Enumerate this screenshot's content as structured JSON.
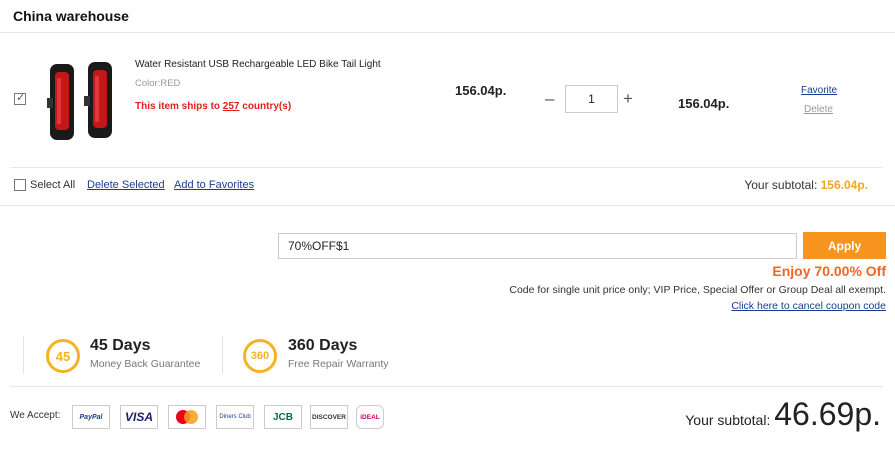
{
  "warehouse": {
    "title": "China warehouse"
  },
  "item": {
    "name": "Water Resistant USB Rechargeable LED Bike Tail Light",
    "color": "Color:RED",
    "ship_prefix": "This item ships to ",
    "ship_count": "257",
    "ship_suffix": " country(s)",
    "price": "156.04p.",
    "quantity": "1",
    "line_total": "156.04p.",
    "favorite_label": "Favorite",
    "delete_label": "Delete",
    "checked": true
  },
  "cart_actions": {
    "select_all": "Select All",
    "delete_selected": "Delete Selected",
    "add_to_favorites": "Add to Favorites",
    "subtotal_label": "Your subtotal: ",
    "subtotal_value": "156.04p."
  },
  "coupon": {
    "code": "70%OFF$1",
    "apply_label": "Apply",
    "enjoy_text": "Enjoy 70.00% Off",
    "note": "Code for single unit price only; VIP Price, Special Offer or Group Deal all exempt.",
    "cancel_link": "Click here to cancel coupon code"
  },
  "guarantees": [
    {
      "badge": "45",
      "title": "45 Days",
      "subtitle": "Money Back Guarantee"
    },
    {
      "badge": "360",
      "title": "360 Days",
      "subtitle": "Free Repair Warranty"
    }
  ],
  "payment": {
    "label": "We Accept:",
    "methods": [
      {
        "icon": "paypal-icon",
        "text": "PayPal"
      },
      {
        "icon": "visa-icon",
        "text": "VISA"
      },
      {
        "icon": "mastercard-icon",
        "text": ""
      },
      {
        "icon": "diners-club-icon",
        "text": "Diners Club"
      },
      {
        "icon": "jcb-icon",
        "text": "JCB"
      },
      {
        "icon": "discover-icon",
        "text": "DISCOVER"
      },
      {
        "icon": "ideal-icon",
        "text": "iDEAL"
      }
    ]
  },
  "totals": {
    "label": "Your subtotal:",
    "value": "46.69p."
  },
  "colors": {
    "accent": "#f7941d",
    "price_orange": "#f5a623",
    "discount_red": "#f26522",
    "link_blue": "#1a3d8f",
    "ship_red": "#e02020"
  }
}
